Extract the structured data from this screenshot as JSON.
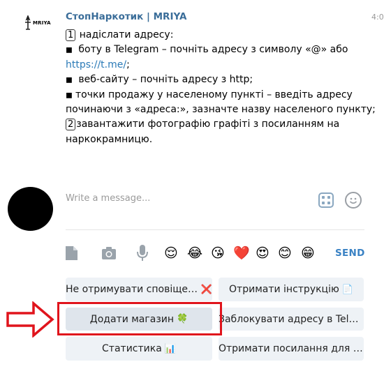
{
  "message": {
    "sender": "СтопНаркотик | MRIYA",
    "time": "4:0",
    "avatar_logo": "MRIYA",
    "lines": {
      "l1_num": "1",
      "l1_text": "надіслати адресу:",
      "l2a": "боту в Telegram – почніть адресу з символу «@» або",
      "l3_link": "https://t.me/",
      "l3_tail": ";",
      "l4": "веб-сайту – почніть адресу з http;",
      "l5": "точки продажу у населеному пункті – введіть адресу",
      "l6": "починаючи з «адреса:», зазначте назву населеного пункту;",
      "l7_num": "2",
      "l7_text": "завантажити фотографію графіті з посиланням на",
      "l8": "наркокрамницю."
    }
  },
  "composer": {
    "placeholder": "Write a message...",
    "send_label": "SEND"
  },
  "toolbar": {
    "emojis": [
      "😌",
      "😂",
      "😘",
      "❤️",
      "😍",
      "😊",
      "😁"
    ]
  },
  "keyboard": {
    "row1": [
      {
        "label": "Не отримувати сповіщення",
        "icon": "❌"
      },
      {
        "label": "Отримати інструкцію",
        "icon": "📄"
      }
    ],
    "row2": [
      {
        "label": "Додати магазин",
        "icon": "🍀"
      },
      {
        "label": "Заблокувати адресу в Tele...",
        "icon": ""
      }
    ],
    "row3": [
      {
        "label": "Статистика",
        "icon": "📊"
      },
      {
        "label": "Отримати посилання для з...",
        "icon": ""
      }
    ]
  },
  "colors": {
    "sender": "#3a6d99",
    "link": "#2a7ab7",
    "send": "#3a82c4",
    "highlight": "#e0141c",
    "button_bg": "#eef2f6"
  }
}
